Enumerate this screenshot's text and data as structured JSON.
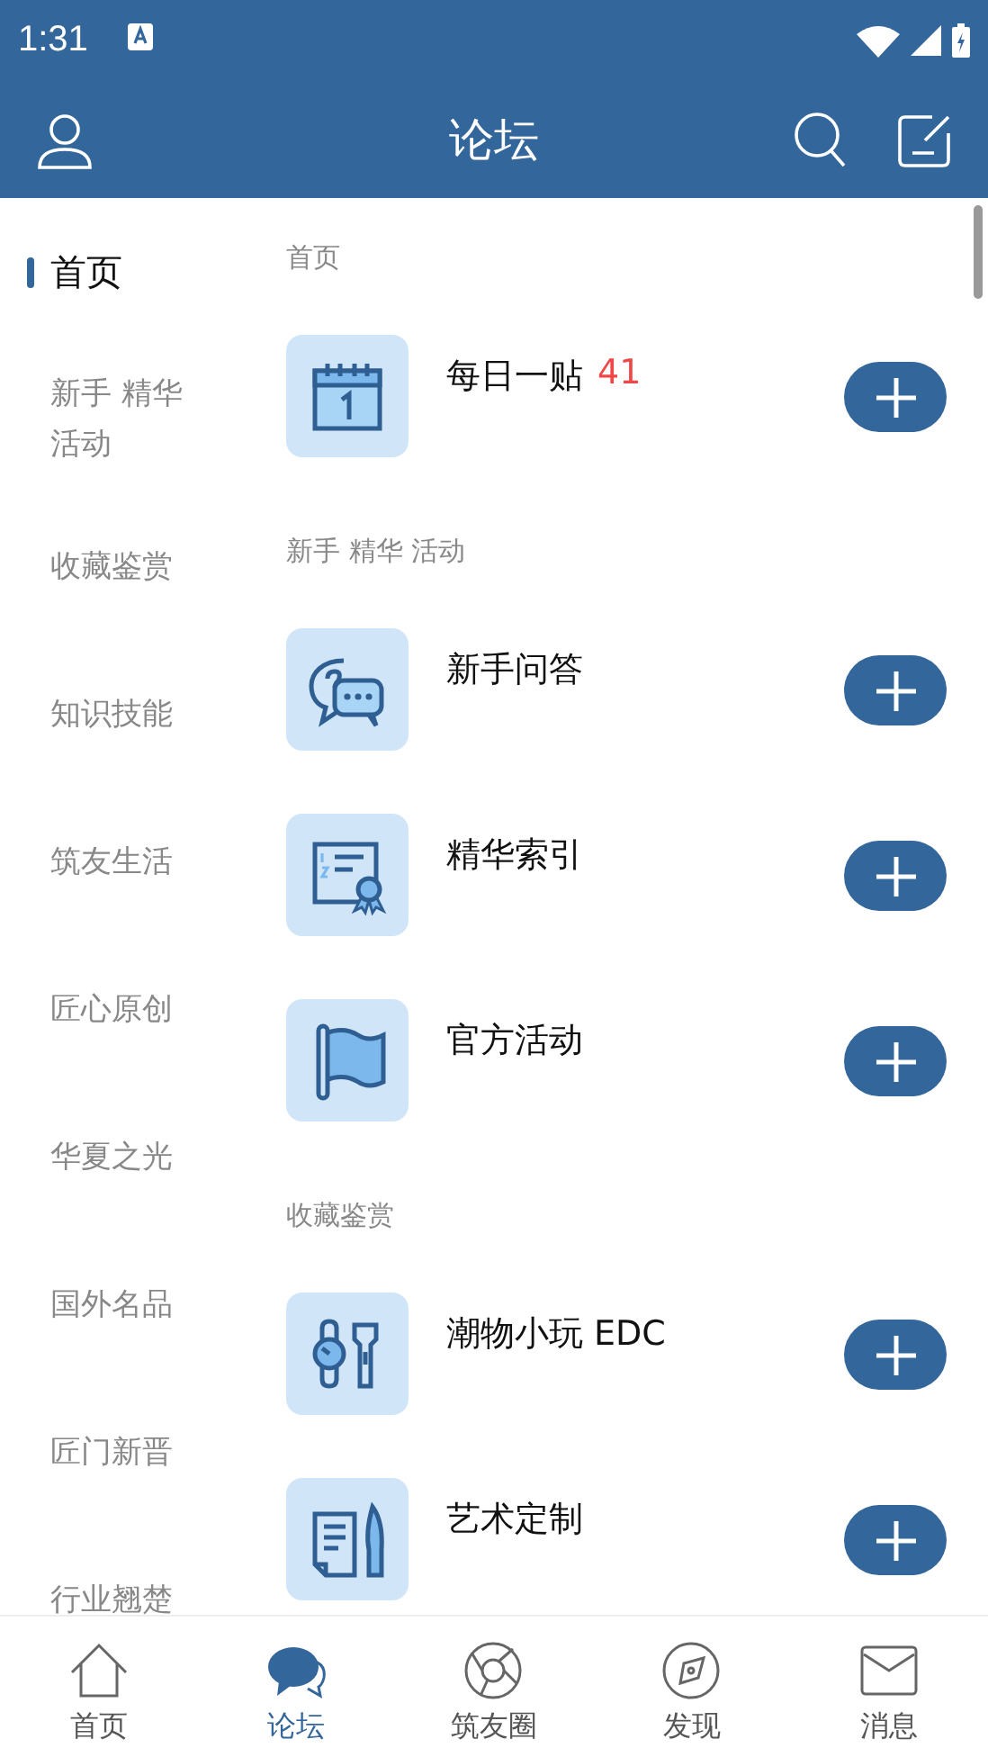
{
  "status_bar": {
    "time": "1:31"
  },
  "header": {
    "title": "论坛"
  },
  "sidebar": {
    "items": [
      {
        "label": "首页",
        "selected": true
      },
      {
        "label": "新手 精华活动",
        "selected": false
      },
      {
        "label": "收藏鉴赏",
        "selected": false
      },
      {
        "label": "知识技能",
        "selected": false
      },
      {
        "label": "筑友生活",
        "selected": false
      },
      {
        "label": "匠心原创",
        "selected": false
      },
      {
        "label": "华夏之光",
        "selected": false
      },
      {
        "label": "国外名品",
        "selected": false
      },
      {
        "label": "匠门新晋",
        "selected": false
      },
      {
        "label": "行业翘楚",
        "selected": false
      }
    ]
  },
  "sections": [
    {
      "title": "首页",
      "forums": [
        {
          "name": "每日一贴",
          "count": "41"
        }
      ]
    },
    {
      "title": "新手 精华 活动",
      "forums": [
        {
          "name": "新手问答"
        },
        {
          "name": "精华索引"
        },
        {
          "name": "官方活动"
        }
      ]
    },
    {
      "title": "收藏鉴赏",
      "forums": [
        {
          "name": "潮物小玩 EDC"
        },
        {
          "name": "艺术定制"
        }
      ]
    }
  ],
  "tab_bar": {
    "tabs": [
      {
        "label": "首页",
        "selected": false
      },
      {
        "label": "论坛",
        "selected": true
      },
      {
        "label": "筑友圈",
        "selected": false
      },
      {
        "label": "发现",
        "selected": false
      },
      {
        "label": "消息",
        "selected": false
      }
    ]
  }
}
